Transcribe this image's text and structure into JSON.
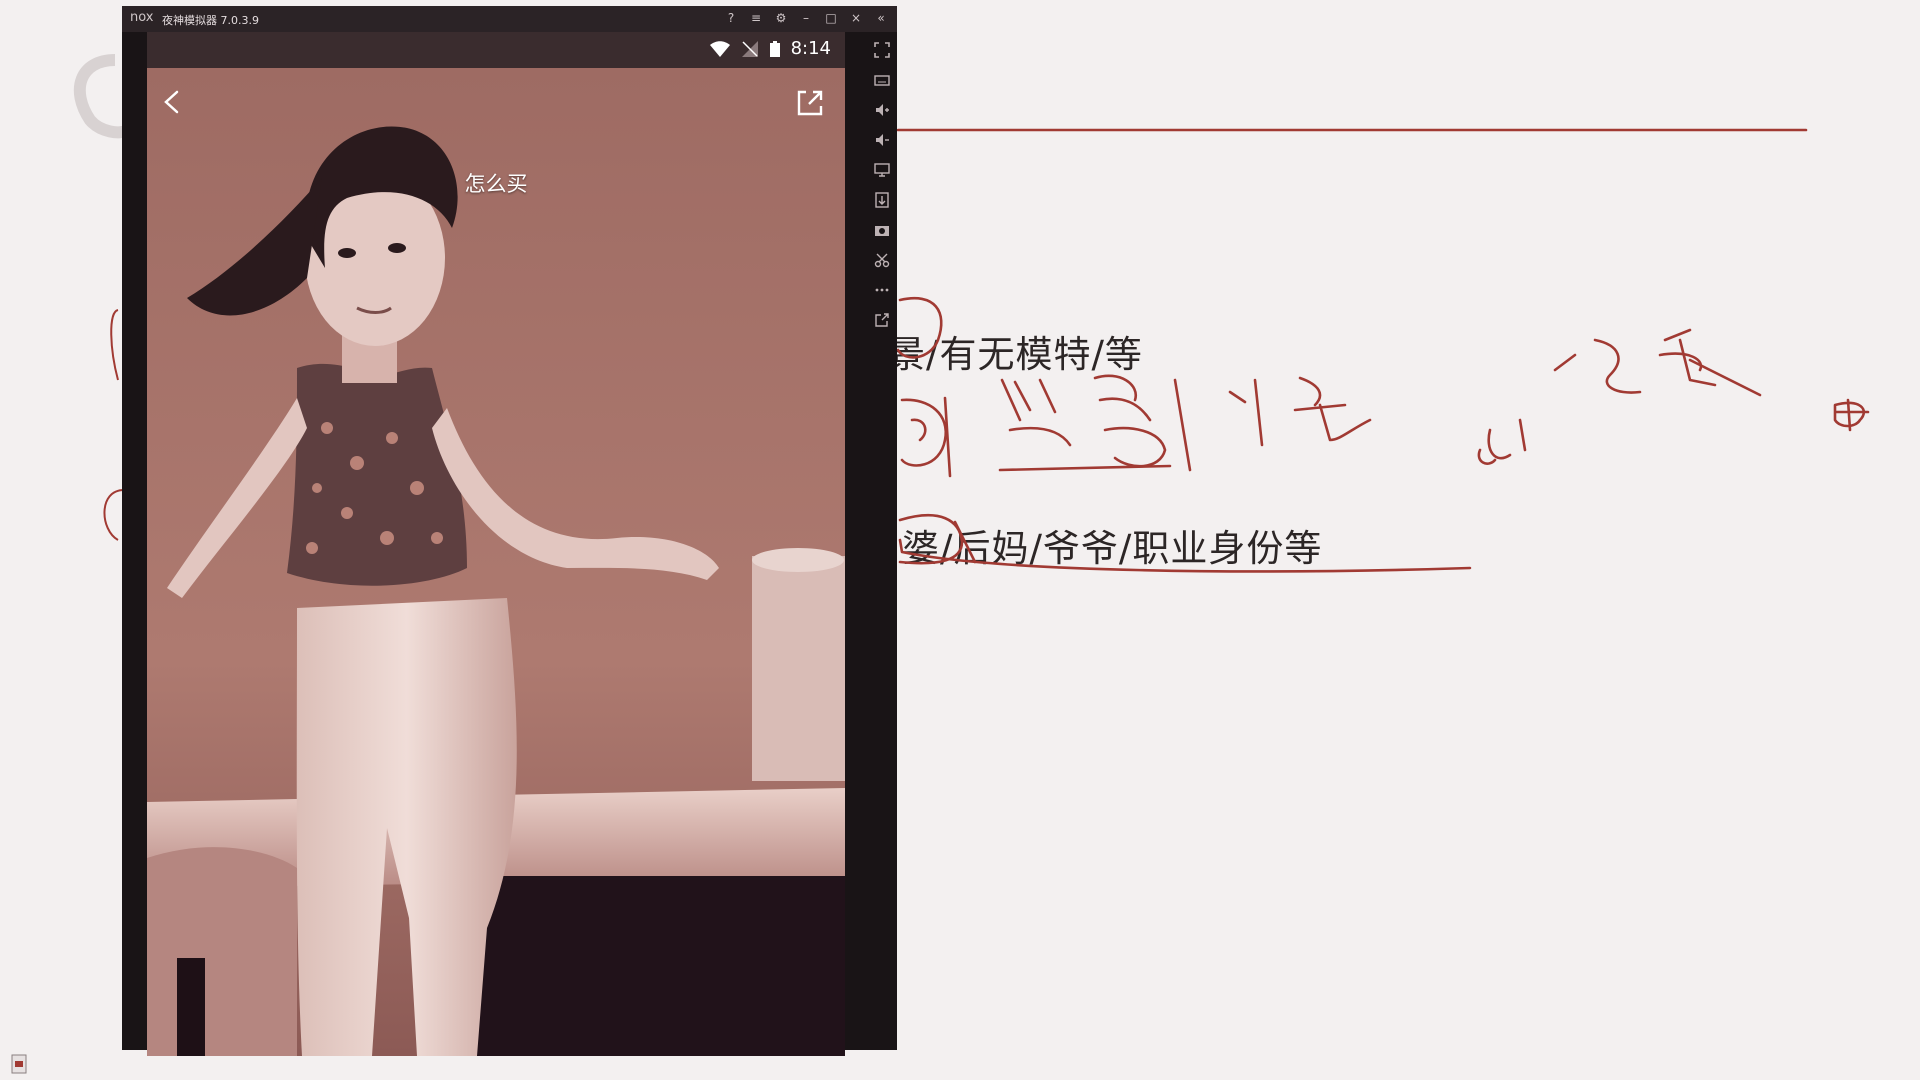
{
  "emulator": {
    "logo": "nox",
    "title": "夜神模拟器 7.0.3.9",
    "window_controls": [
      "?",
      "≡",
      "⚙",
      "–",
      "□",
      "×",
      "«"
    ]
  },
  "phone": {
    "status": {
      "time": "8:14",
      "icons": [
        "wifi-icon",
        "signal-icon",
        "battery-icon"
      ]
    },
    "video_caption": "怎么买"
  },
  "slide": {
    "line1": "景/有无模特/等",
    "line2": "婆/后妈/爷爷/职业身份等"
  },
  "colors": {
    "ink": "#a13a33",
    "video_tint": "#a87268",
    "emulator_frame": "#191416"
  }
}
